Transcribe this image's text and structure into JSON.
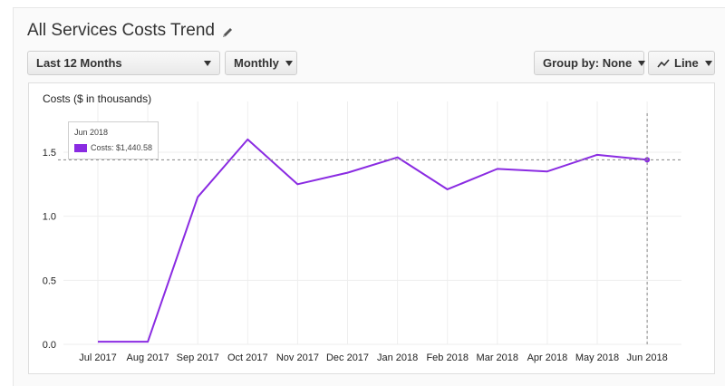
{
  "header": {
    "title": "All Services Costs Trend",
    "edit_icon": "pencil-icon"
  },
  "controls": {
    "range_label": "Last 12 Months",
    "granularity_label": "Monthly",
    "groupby_label": "Group by: None",
    "charttype_label": "Line",
    "charttype_icon": "line-chart-icon"
  },
  "tooltip": {
    "date": "Jun 2018",
    "text": "Costs: $1,440.58"
  },
  "colors": {
    "series": "#8a2be2",
    "grid": "#eeeeee"
  },
  "chart_data": {
    "type": "line",
    "ylabel": "Costs ($ in thousands)",
    "categories": [
      "Jul 2017",
      "Aug 2017",
      "Sep 2017",
      "Oct 2017",
      "Nov 2017",
      "Dec 2017",
      "Jan 2018",
      "Feb 2018",
      "Mar 2018",
      "Apr 2018",
      "May 2018",
      "Jun 2018"
    ],
    "series": [
      {
        "name": "Costs",
        "values": [
          0.02,
          0.02,
          1.15,
          1.6,
          1.25,
          1.34,
          1.46,
          1.21,
          1.37,
          1.35,
          1.48,
          1.44058
        ]
      }
    ],
    "yticks": [
      "0.0",
      "0.5",
      "1.0",
      "1.5"
    ],
    "ylim": [
      0,
      1.5
    ],
    "grid": true,
    "highlight_index": 11
  }
}
